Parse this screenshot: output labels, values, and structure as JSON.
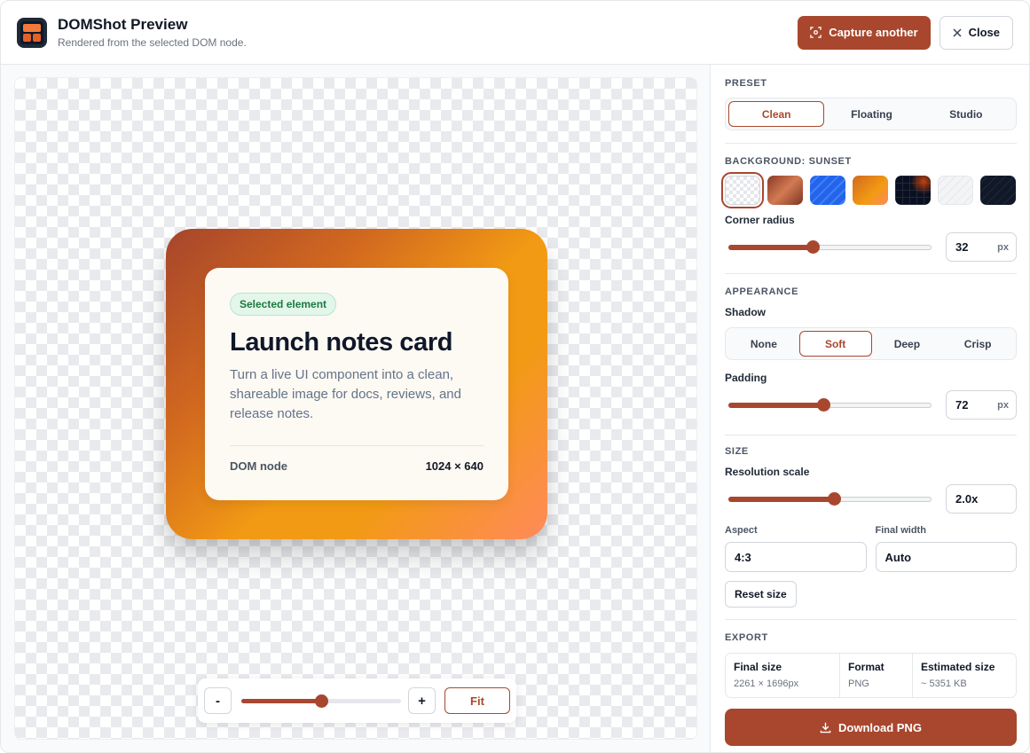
{
  "header": {
    "title": "DOMShot Preview",
    "subtitle": "Rendered from the selected DOM node.",
    "capture_label": "Capture another",
    "close_label": "Close"
  },
  "preview": {
    "badge": "Selected element",
    "card_title": "Launch notes card",
    "card_description": "Turn a live UI component into a clean, shareable image for docs, reviews, and release notes.",
    "footer_key": "DOM node",
    "footer_value": "1024 × 640"
  },
  "zoom": {
    "minus_label": "-",
    "plus_label": "+",
    "fit_label": "Fit",
    "level_fraction": 0.5
  },
  "panel": {
    "preset": {
      "label": "PRESET",
      "options": [
        "Clean",
        "Floating",
        "Studio"
      ],
      "selected": "Clean"
    },
    "background": {
      "label": "BACKGROUND: SUNSET",
      "swatches": [
        "transparent",
        "copper",
        "blue",
        "sunset",
        "grid-dark",
        "light-lines",
        "dark-lines"
      ],
      "selected_index": 0
    },
    "corner_radius": {
      "label": "Corner radius",
      "value": "32",
      "unit": "px",
      "fraction": 0.41
    },
    "appearance": {
      "label": "APPEARANCE",
      "shadow_label": "Shadow",
      "shadow_options": [
        "None",
        "Soft",
        "Deep",
        "Crisp"
      ],
      "shadow_selected": "Soft",
      "padding_label": "Padding",
      "padding_value": "72",
      "padding_unit": "px",
      "padding_fraction": 0.46
    },
    "size": {
      "label": "SIZE",
      "resolution_label": "Resolution scale",
      "resolution_value": "2.0x",
      "resolution_fraction": 0.51,
      "aspect_label": "Aspect",
      "aspect_value": "4:3",
      "width_label": "Final width",
      "width_value": "Auto",
      "reset_label": "Reset size"
    },
    "export": {
      "label": "EXPORT",
      "final_size_label": "Final size",
      "final_size_value": "2261 × 1696px",
      "format_label": "Format",
      "format_value": "PNG",
      "estimated_label": "Estimated size",
      "estimated_value": "~ 5351 KB",
      "download_label": "Download PNG"
    }
  },
  "colors": {
    "accent": "#a8472e",
    "badge_green": "#1a7a3f"
  }
}
